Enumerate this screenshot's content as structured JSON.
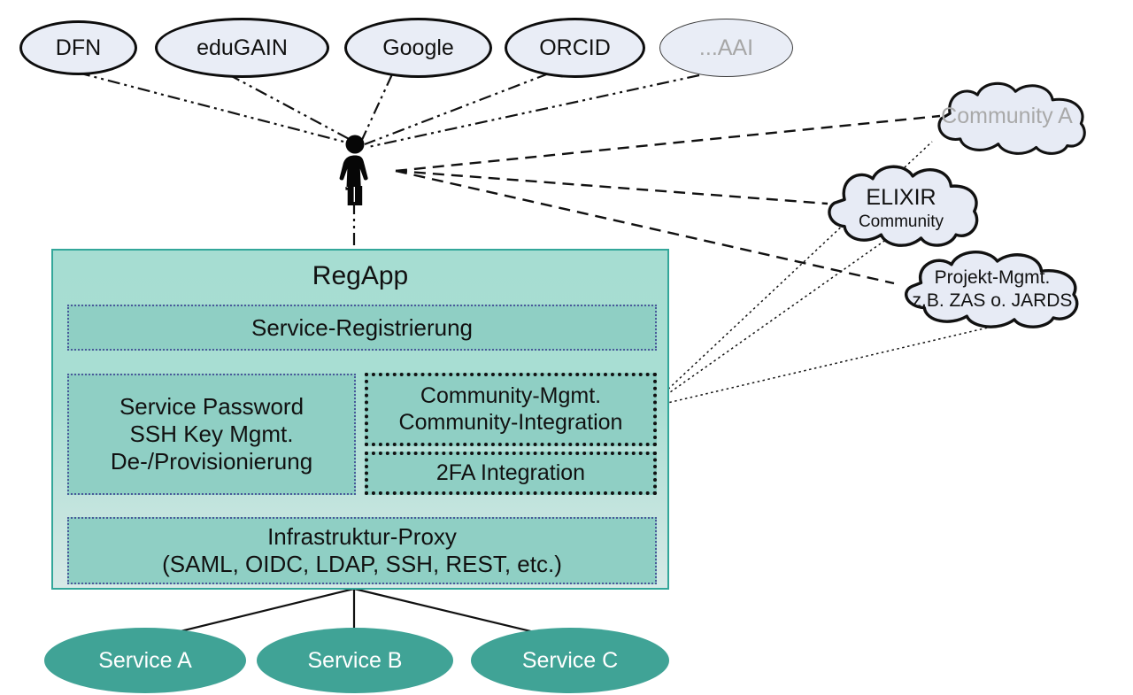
{
  "title": "RegApp architecture diagram",
  "colors": {
    "regapp_fill_top": "#a6ddd2",
    "regapp_fill_bottom": "#d6e9e6",
    "regapp_border": "#33a79a",
    "panel_fill": "#8fcfc4",
    "panel_border_thin": "#4a5a9a",
    "panel_border_thick": "#111111",
    "idp_fill": "#e9edf6",
    "idp_border": "#0d0d0d",
    "cloud_fill": "#e7ebf5",
    "cloud_border": "#111111",
    "service_fill": "#40a396",
    "service_text": "#ffffff",
    "faded_text": "#a9a9a9"
  },
  "identity_providers": [
    {
      "label": "DFN",
      "faded": false
    },
    {
      "label": "eduGAIN",
      "faded": false
    },
    {
      "label": "Google",
      "faded": false
    },
    {
      "label": "ORCID",
      "faded": false
    },
    {
      "label": "...AAI",
      "faded": true
    }
  ],
  "user": {
    "icon": "person-icon",
    "label": ""
  },
  "clouds": [
    {
      "line1": "Community A",
      "line2": "",
      "faded": true
    },
    {
      "line1": "ELIXIR",
      "line2": "Community",
      "faded": false
    },
    {
      "line1": "Projekt-Mgmt.",
      "line2": "z.B. ZAS o. JARDS",
      "faded": false
    }
  ],
  "regapp": {
    "title": "RegApp",
    "panels": [
      {
        "id": "service-registrierung",
        "lines": [
          "Service-Registrierung"
        ],
        "border": "thin"
      },
      {
        "id": "service-password",
        "lines": [
          "Service Password",
          "SSH Key Mgmt.",
          "De-/Provisionierung"
        ],
        "border": "thin"
      },
      {
        "id": "community-mgmt",
        "lines": [
          "Community-Mgmt.",
          "Community-Integration"
        ],
        "border": "thick"
      },
      {
        "id": "2fa-integration",
        "lines": [
          "2FA Integration"
        ],
        "border": "thick"
      },
      {
        "id": "infrastruktur-proxy",
        "lines": [
          "Infrastruktur-Proxy",
          "(SAML, OIDC, LDAP, SSH, REST, etc.)"
        ],
        "border": "thin"
      }
    ]
  },
  "services": [
    {
      "label": "Service A"
    },
    {
      "label": "Service B"
    },
    {
      "label": "Service C"
    }
  ]
}
